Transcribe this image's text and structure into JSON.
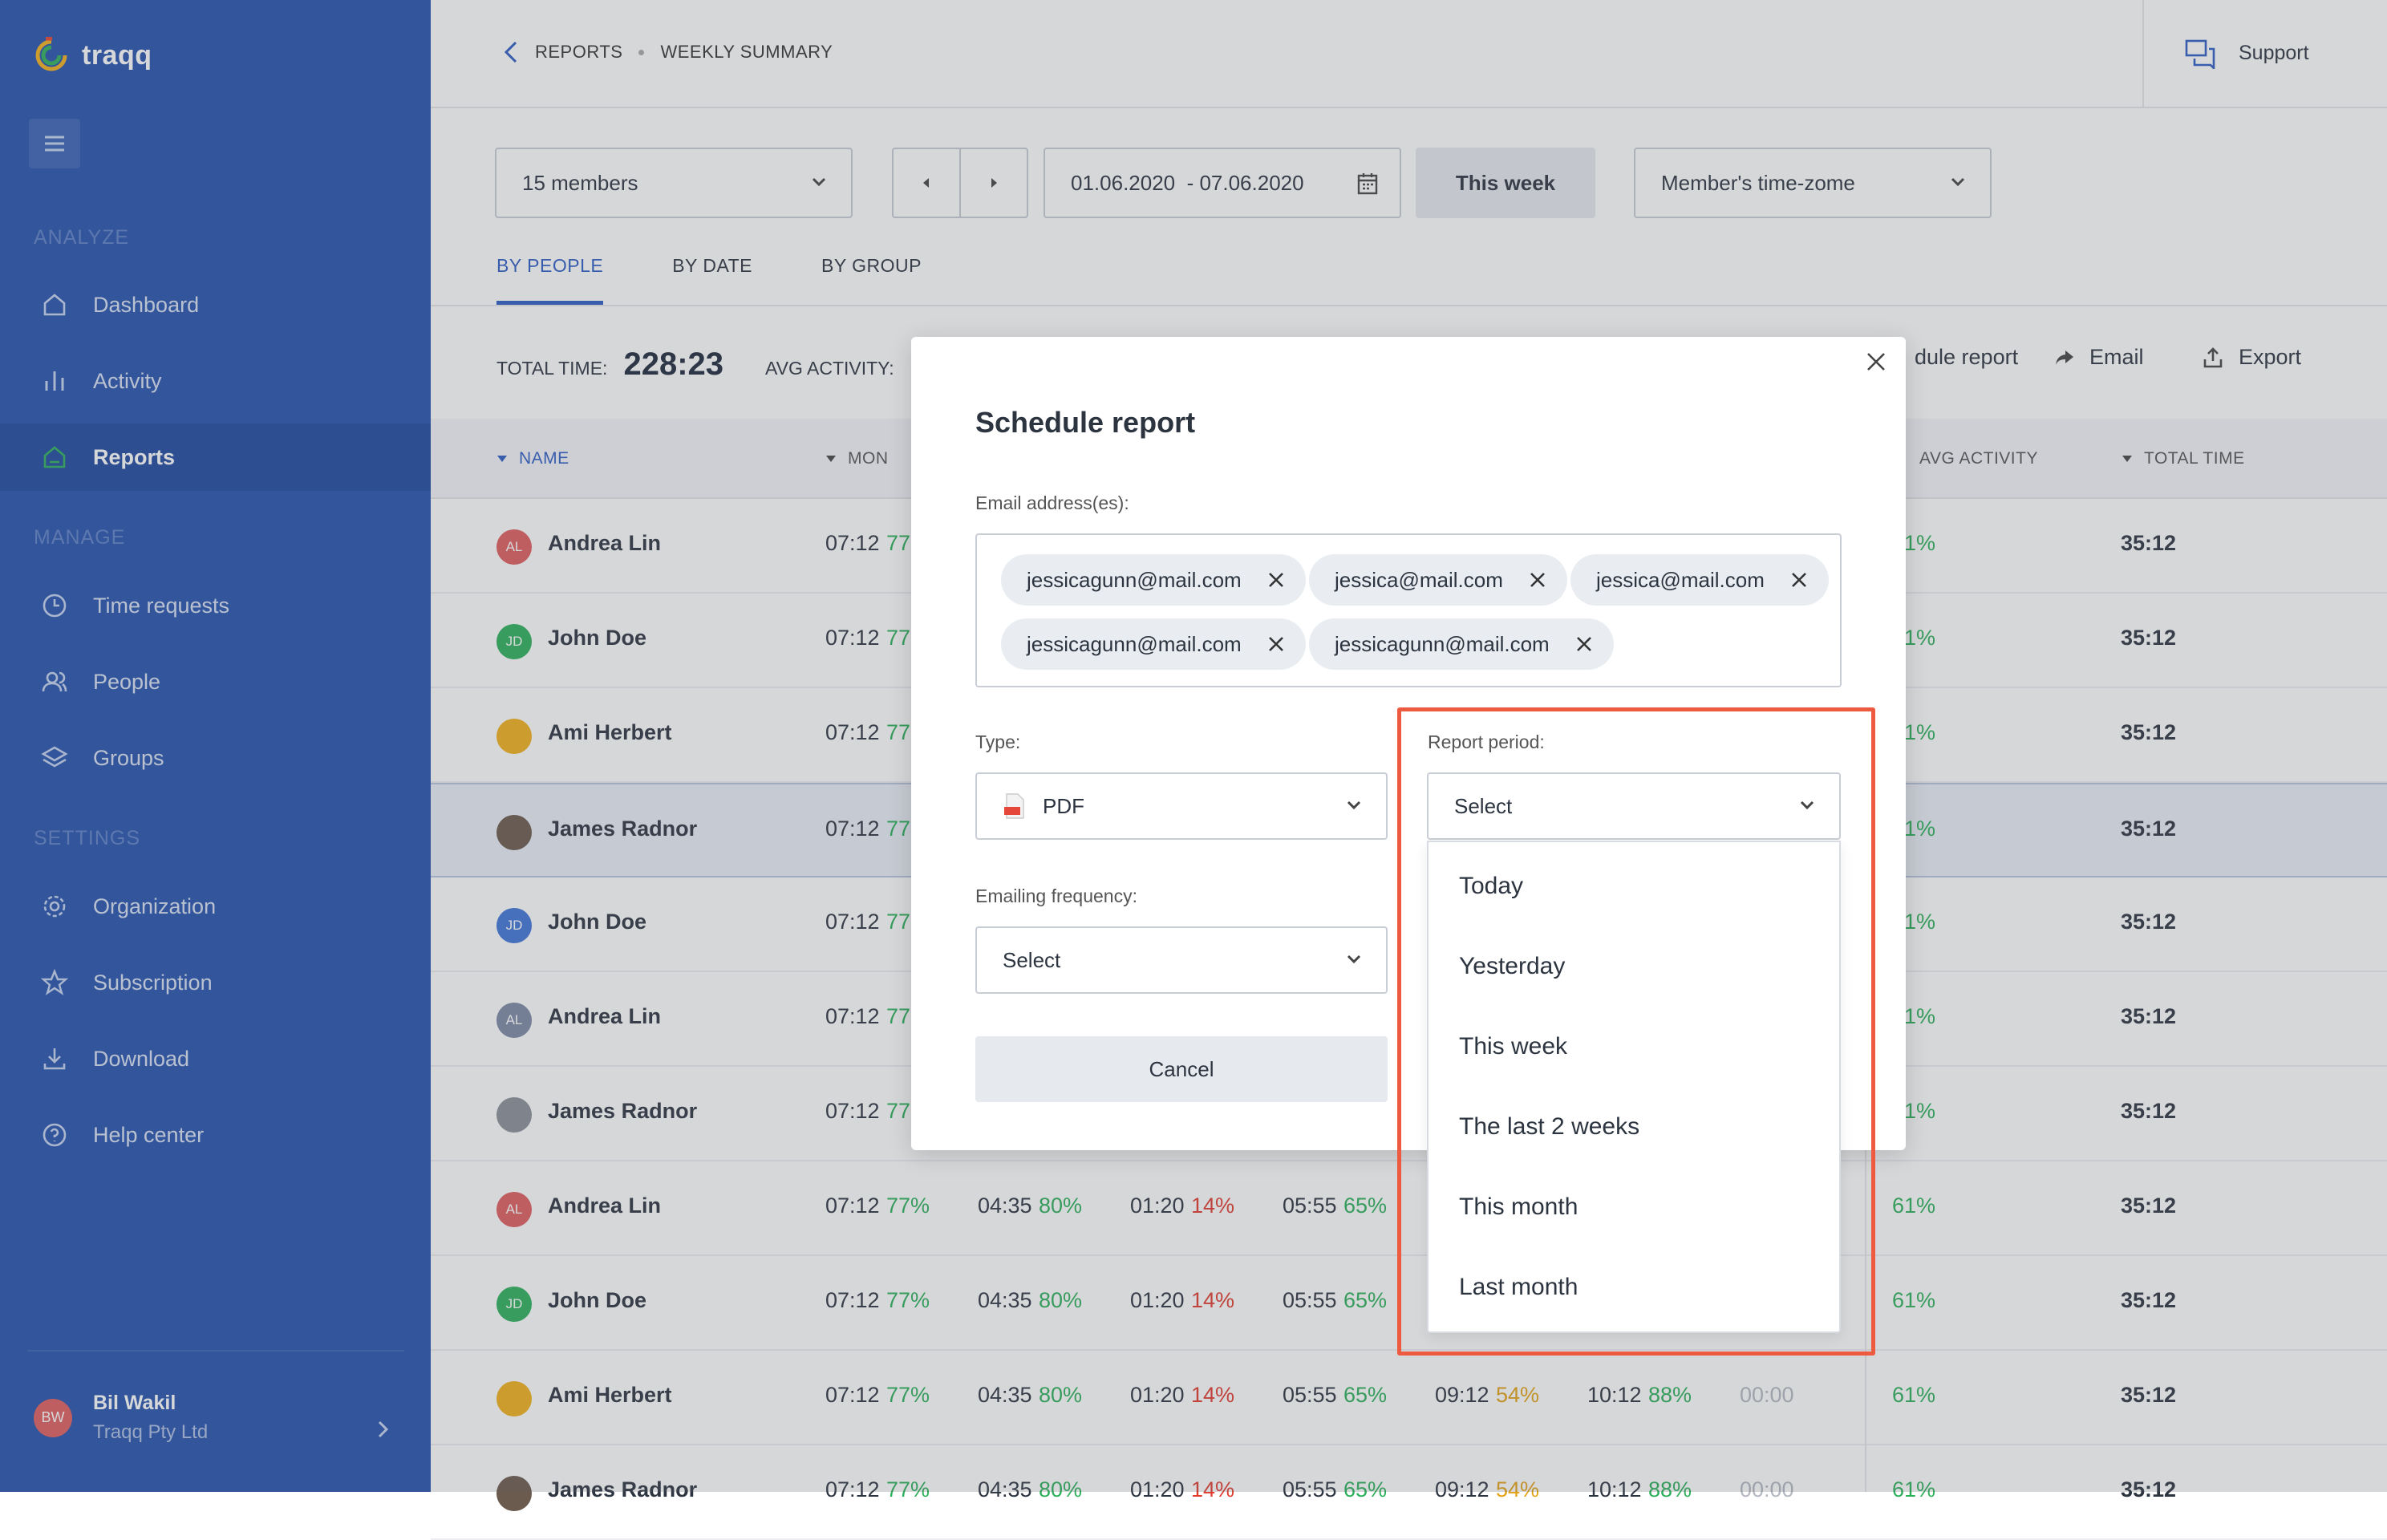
{
  "app": {
    "name": "traqq",
    "accent": "#2452ac",
    "brand_green": "#2bb05a"
  },
  "sidebar": {
    "sections": {
      "analyze": "ANALYZE",
      "manage": "MANAGE",
      "settings": "SETTINGS"
    },
    "items": [
      {
        "label": "Dashboard",
        "icon": "home-icon"
      },
      {
        "label": "Activity",
        "icon": "bar-chart-icon"
      },
      {
        "label": "Reports",
        "icon": "reports-icon",
        "active": true
      },
      {
        "label": "Time requests",
        "icon": "clock-icon"
      },
      {
        "label": "People",
        "icon": "people-icon"
      },
      {
        "label": "Groups",
        "icon": "layers-icon"
      },
      {
        "label": "Organization",
        "icon": "gear-icon"
      },
      {
        "label": "Subscription",
        "icon": "star-icon"
      },
      {
        "label": "Download",
        "icon": "download-icon"
      },
      {
        "label": "Help center",
        "icon": "help-icon"
      }
    ],
    "user": {
      "initials": "BW",
      "name": "Bil Wakil",
      "org": "Traqq Pty Ltd"
    }
  },
  "header": {
    "crumbs": [
      "REPORTS",
      "WEEKLY SUMMARY"
    ],
    "support": "Support"
  },
  "filters": {
    "members": "15 members",
    "date_range": "01.06.2020  - 07.06.2020",
    "this_week": "This week",
    "timezone": "Member's time-zome"
  },
  "tabs": [
    "BY PEOPLE",
    "BY DATE",
    "BY GROUP"
  ],
  "totals": {
    "total_label": "TOTAL TIME:",
    "total_value": "228:23",
    "avg_label": "AVG ACTIVITY:"
  },
  "actions": {
    "schedule": "dule report",
    "email": "Email",
    "export": "Export"
  },
  "table": {
    "headers": {
      "name": "NAME",
      "mon": "MON",
      "avg": "AVG ACTIVITY",
      "total": "TOTAL TIME"
    },
    "rows": [
      {
        "name": "Andrea Lin",
        "initials": "AL",
        "mon": "07:12",
        "mon_pct": "77",
        "avg": "61%",
        "total": "35:12"
      },
      {
        "name": "John Doe",
        "initials": "JD",
        "mon": "07:12",
        "mon_pct": "77",
        "avg": "61%",
        "total": "35:12"
      },
      {
        "name": "Ami Herbert",
        "initials": "",
        "mon": "07:12",
        "mon_pct": "77",
        "avg": "61%",
        "total": "35:12"
      },
      {
        "name": "James Radnor",
        "initials": "",
        "mon": "07:12",
        "mon_pct": "77",
        "avg": "61%",
        "total": "35:12"
      },
      {
        "name": "John Doe",
        "initials": "JD",
        "mon": "07:12",
        "mon_pct": "77",
        "avg": "61%",
        "total": "35:12"
      },
      {
        "name": "Andrea Lin",
        "initials": "AL",
        "mon": "07:12",
        "mon_pct": "77",
        "avg": "61%",
        "total": "35:12"
      },
      {
        "name": "James Radnor",
        "initials": "",
        "mon": "07:12",
        "mon_pct": "77",
        "avg": "61%",
        "total": "35:12"
      },
      {
        "name": "Andrea Lin",
        "initials": "AL",
        "c1": "07:12",
        "c1p": "77%",
        "c2": "04:35",
        "c2p": "80%",
        "c3": "01:20",
        "c3p": "14%",
        "c4": "05:55",
        "c4p": "65%",
        "avg": "61%",
        "total": "35:12"
      },
      {
        "name": "John Doe",
        "initials": "JD",
        "c1": "07:12",
        "c1p": "77%",
        "c2": "04:35",
        "c2p": "80%",
        "c3": "01:20",
        "c3p": "14%",
        "c4": "05:55",
        "c4p": "65%",
        "avg": "61%",
        "total": "35:12"
      },
      {
        "name": "Ami Herbert",
        "initials": "",
        "c1": "07:12",
        "c1p": "77%",
        "c2": "04:35",
        "c2p": "80%",
        "c3": "01:20",
        "c3p": "14%",
        "c4": "05:55",
        "c4p": "65%",
        "c5": "09:12",
        "c5p": "54%",
        "c6": "10:12",
        "c6p": "88%",
        "c7": "00:00",
        "avg": "61%",
        "total": "35:12"
      },
      {
        "name": "James Radnor",
        "initials": "",
        "c1": "07:12",
        "c1p": "77%",
        "c2": "04:35",
        "c2p": "80%",
        "c3": "01:20",
        "c3p": "14%",
        "c4": "05:55",
        "c4p": "65%",
        "c5": "09:12",
        "c5p": "54%",
        "c6": "10:12",
        "c6p": "88%",
        "c7": "00:00",
        "avg": "61%",
        "total": "35:12"
      }
    ]
  },
  "modal": {
    "title": "Schedule report",
    "email_label": "Email address(es):",
    "emails": [
      "jessicagunn@mail.com",
      "jessica@mail.com",
      "jessica@mail.com",
      "jessicagunn@mail.com",
      "jessicagunn@mail.com"
    ],
    "type_label": "Type:",
    "type_value": "PDF",
    "period_label": "Report period:",
    "period_value": "Select",
    "freq_label": "Emailing frequency:",
    "freq_value": "Select",
    "cancel": "Cancel",
    "period_options": [
      "Today",
      "Yesterday",
      "This week",
      "The last 2 weeks",
      "This month",
      "Last month"
    ]
  }
}
